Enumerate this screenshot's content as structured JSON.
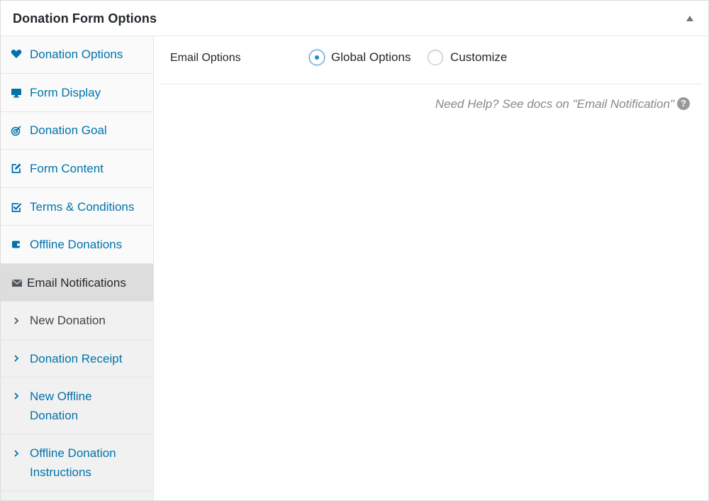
{
  "panel": {
    "title": "Donation Form Options"
  },
  "sidebar": {
    "items": [
      {
        "label": "Donation Options",
        "icon": "heart-icon"
      },
      {
        "label": "Form Display",
        "icon": "monitor-icon"
      },
      {
        "label": "Donation Goal",
        "icon": "target-icon"
      },
      {
        "label": "Form Content",
        "icon": "edit-icon"
      },
      {
        "label": "Terms & Conditions",
        "icon": "checkbox-icon"
      },
      {
        "label": "Offline Donations",
        "icon": "wallet-icon"
      },
      {
        "label": "Email Notifications",
        "icon": "envelope-icon"
      }
    ],
    "subitems": [
      {
        "label": "New Donation"
      },
      {
        "label": "Donation Receipt"
      },
      {
        "line1": "New Offline",
        "line2": "Donation"
      },
      {
        "line1": "Offline Donation",
        "line2": "Instructions"
      }
    ]
  },
  "email_options": {
    "label": "Email Options",
    "options": [
      "Global Options",
      "Customize"
    ],
    "selected": "Global Options"
  },
  "help": {
    "text": "Need Help? See docs on \"Email Notification\"",
    "icon_glyph": "?"
  },
  "colors": {
    "link": "#0073aa",
    "active_bg": "#dddddd",
    "accent": "#1e8cbe"
  }
}
